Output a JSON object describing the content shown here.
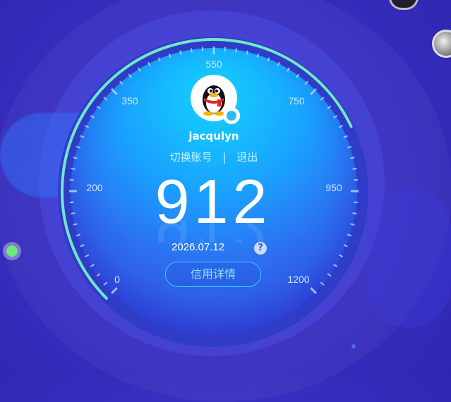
{
  "user": {
    "username": "jacqulyn"
  },
  "actions": {
    "switch_account": "切换账号",
    "separator": "|",
    "logout": "退出"
  },
  "credit": {
    "score": "912",
    "date": "2026.07.12",
    "help_symbol": "?",
    "detail_button": "信用详情",
    "gauge_fill_fraction": 0.74
  },
  "gauge_labels": [
    "0",
    "200",
    "350",
    "550",
    "750",
    "950",
    "1200"
  ],
  "icons": {
    "avatar": "qq-penguin-icon",
    "badge": "qq-status-icon",
    "help": "question-icon"
  },
  "colors": {
    "background": "#3a2fc4",
    "accent": "#35d2ff",
    "progress": "#6ee8c8",
    "status_dot": "#6ee87a"
  }
}
